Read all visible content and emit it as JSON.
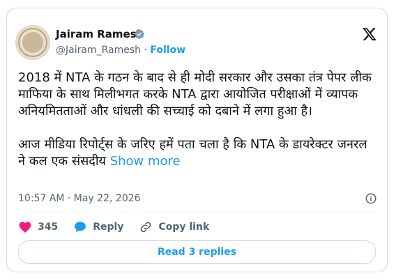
{
  "author": {
    "name": "Jairam Ramesh",
    "handle": "@Jairam_Ramesh",
    "separator": "·",
    "follow_label": "Follow"
  },
  "tweet": {
    "text": "2018 में NTA के गठन के बाद से ही मोदी सरकार और उसका तंत्र पेपर लीक माफिया के साथ मिलीभगत करके NTA द्वारा आयोजित परीक्षाओं में व्यापक अनियमितताओं और धांधली की सच्चाई को दबाने में लगा हुआ है।\n\nआज मीडिया रिपोर्ट्स के जरिए हमें पता चला है कि NTA के डायरेक्टर जनरल ने कल एक संसदीय ",
    "show_more": "Show more",
    "timestamp": "10:57 AM · May 22, 2026"
  },
  "actions": {
    "like_count": "345",
    "reply_label": "Reply",
    "copy_link_label": "Copy link"
  },
  "replies_button": "Read 3 replies",
  "colors": {
    "accent": "#1d9bf0",
    "like": "#f91880",
    "text": "#0f1419",
    "muted": "#536471"
  },
  "icons": [
    "verified-icon",
    "x-logo-icon",
    "info-icon",
    "heart-icon",
    "reply-icon",
    "link-icon"
  ]
}
